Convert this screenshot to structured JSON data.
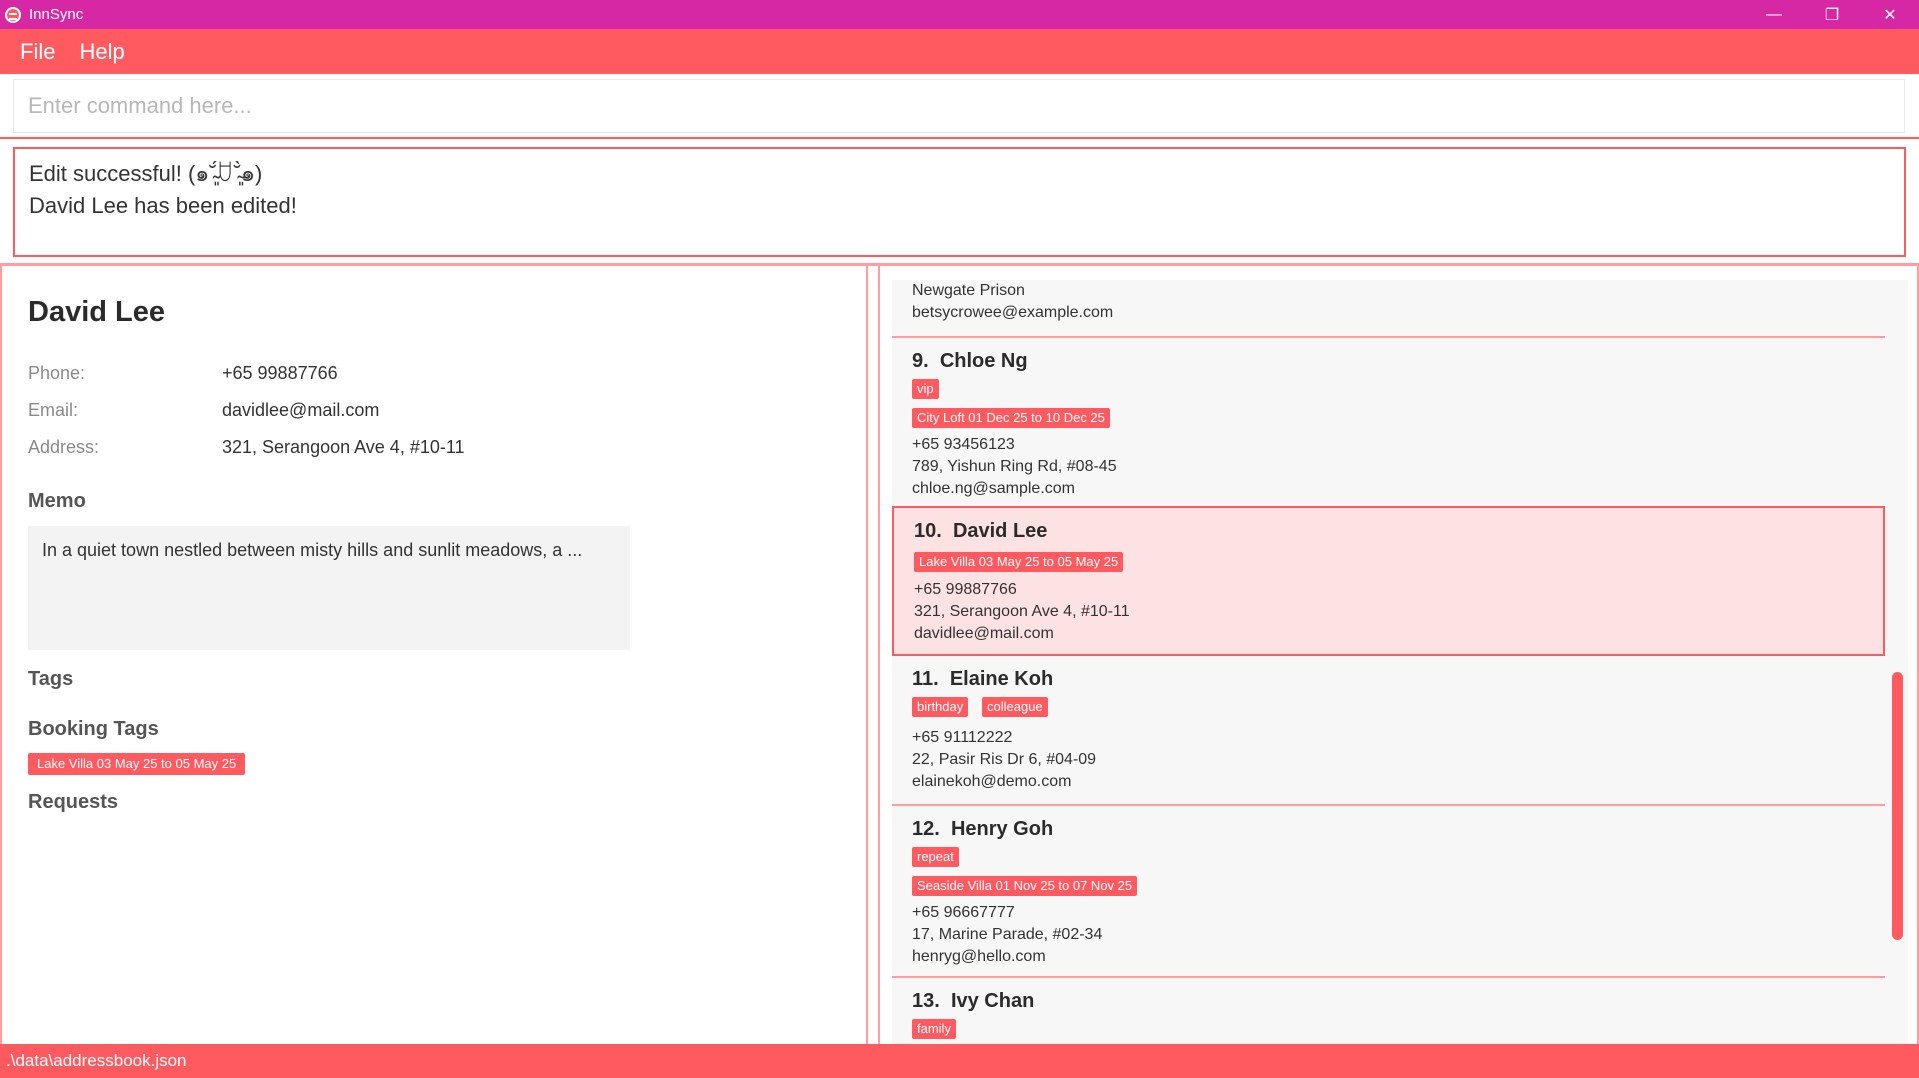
{
  "window": {
    "title": "InnSync",
    "minimize": "—",
    "restore": "❐",
    "close": "✕"
  },
  "menu": {
    "file": "File",
    "help": "Help"
  },
  "command": {
    "placeholder": "Enter command here...",
    "value": ""
  },
  "result": {
    "line1": "Edit successful! (๑˘̴͈́ꇴ˘̴͈̀๑)",
    "line2": "David Lee has been edited!"
  },
  "detail": {
    "name": "David Lee",
    "phone_label": "Phone:",
    "phone": "+65 99887766",
    "email_label": "Email:",
    "email": "davidlee@mail.com",
    "address_label": "Address:",
    "address": "321, Serangoon Ave 4, #10-11",
    "memo_title": "Memo",
    "memo": "In a quiet town nestled between misty hills and sunlit meadows, a ...",
    "tags_title": "Tags",
    "booking_title": "Booking Tags",
    "booking_tag": "Lake Villa 03 May 25 to 05 May 25",
    "requests_title": "Requests"
  },
  "guests": [
    {
      "partial": true,
      "address": "Newgate Prison",
      "email": "betsycrowee@example.com"
    },
    {
      "index": "9.",
      "name": "Chloe Ng",
      "tags": [
        "vip"
      ],
      "booking": "City Loft 01 Dec 25 to 10 Dec 25",
      "phone": "+65 93456123",
      "address": "789, Yishun Ring Rd, #08-45",
      "email": "chloe.ng@sample.com"
    },
    {
      "index": "10.",
      "name": "David Lee",
      "tags": [],
      "booking": "Lake Villa 03 May 25 to 05 May 25",
      "phone": "+65 99887766",
      "address": "321, Serangoon Ave 4, #10-11",
      "email": "davidlee@mail.com",
      "selected": true
    },
    {
      "index": "11.",
      "name": "Elaine Koh",
      "tags": [
        "birthday",
        "colleague"
      ],
      "booking": "",
      "phone": "+65 91112222",
      "address": "22, Pasir Ris Dr 6, #04-09",
      "email": "elainekoh@demo.com"
    },
    {
      "index": "12.",
      "name": "Henry Goh",
      "tags": [
        "repeat"
      ],
      "booking": "Seaside Villa 01 Nov 25 to 07 Nov 25",
      "phone": "+65 96667777",
      "address": "17, Marine Parade, #02-34",
      "email": "henryg@hello.com"
    },
    {
      "index": "13.",
      "name": "Ivy Chan",
      "tags": [
        "family"
      ]
    }
  ],
  "status": {
    "path": ".\\data\\addressbook.json"
  },
  "colors": {
    "titlebar": "#d627a5",
    "accent": "#ff5a60",
    "selected_bg": "#fde2e4"
  }
}
